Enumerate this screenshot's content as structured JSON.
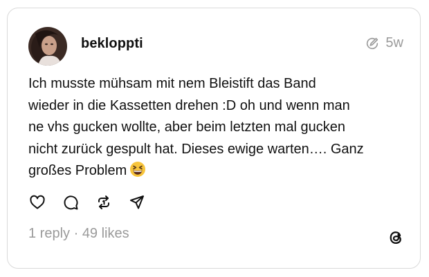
{
  "post": {
    "username": "bekloppti",
    "time": "5w",
    "text": "Ich musste mühsam mit nem Bleistift das Band\nwieder in die Kassetten drehen :D oh und wenn man\nne vhs gucken wollte, aber beim letzten mal gucken\nnicht zurück gespult hat. Dieses ewige warten…. Ganz\ngroßes Problem",
    "emoji": "grinning-squinting-face-emoji"
  },
  "stats": {
    "replies": "1 reply",
    "separator": " · ",
    "likes": "49 likes"
  },
  "icons": {
    "like": "heart-icon",
    "reply": "comment-icon",
    "repost": "repost-icon",
    "share": "send-icon",
    "edited": "edited-icon",
    "logo": "threads-logo"
  },
  "colors": {
    "text": "#101010",
    "muted": "#9a9a9a",
    "border": "#d9d9d9",
    "emoji": "#f7c43c"
  }
}
